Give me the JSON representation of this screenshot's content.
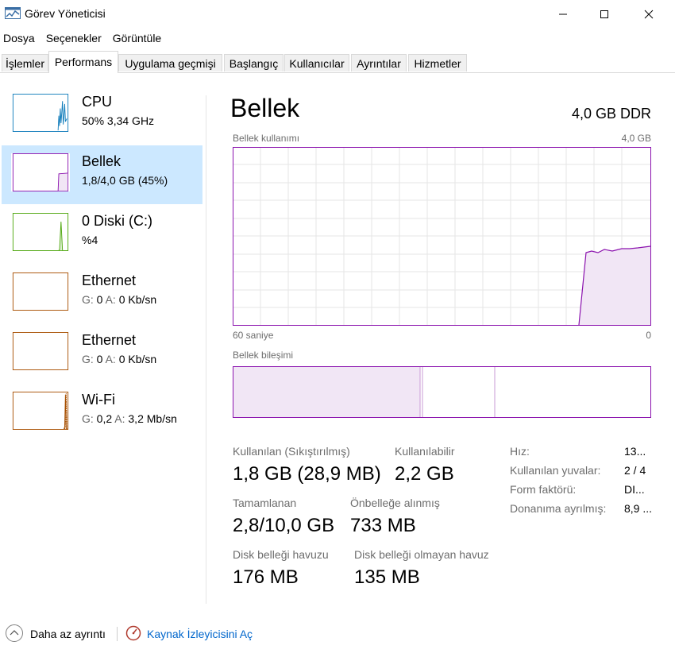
{
  "window": {
    "title": "Görev Yöneticisi",
    "app_icon": "task-manager-icon",
    "controls": [
      "minimize-icon",
      "maximize-icon",
      "close-icon"
    ]
  },
  "menu": {
    "items": [
      "Dosya",
      "Seçenekler",
      "Görüntüle"
    ]
  },
  "tabs": [
    {
      "label": "İşlemler"
    },
    {
      "label": "Performans",
      "active": true
    },
    {
      "label": "Uygulama geçmişi"
    },
    {
      "label": "Başlangıç"
    },
    {
      "label": "Kullanıcılar"
    },
    {
      "label": "Ayrıntılar"
    },
    {
      "label": "Hizmetler"
    }
  ],
  "sidebar": {
    "items": [
      {
        "title": "CPU",
        "subtitle": "50%  3,34 GHz",
        "color": "#117dbb"
      },
      {
        "title": "Bellek",
        "subtitle": "1,8/4,0 GB (45%)",
        "color": "#8b12ae",
        "selected": true
      },
      {
        "title": "0 Diski (C:)",
        "subtitle": "%4",
        "color": "#4da60c"
      },
      {
        "title": "Ethernet",
        "sub_g_label": "G:",
        "sub_g_value": "0",
        "sub_a_label": "A:",
        "sub_a_value": "0 Kb/sn",
        "color": "#a74f01"
      },
      {
        "title": "Ethernet",
        "sub_g_label": "G:",
        "sub_g_value": "0",
        "sub_a_label": "A:",
        "sub_a_value": "0 Kb/sn",
        "color": "#a74f01"
      },
      {
        "title": "Wi-Fi",
        "sub_g_label": "G:",
        "sub_g_value": "0,2",
        "sub_a_label": "A:",
        "sub_a_value": "3,2 Mb/sn",
        "color": "#a74f01"
      }
    ]
  },
  "main": {
    "title": "Bellek",
    "mem_type": "4,0 GB DDR",
    "usage_label": "Bellek kullanımı",
    "usage_max": "4,0 GB",
    "time_left": "60 saniye",
    "time_right": "0",
    "composition_label": "Bellek bileşimi",
    "accent": "#8b12ae",
    "stats": {
      "in_use_label": "Kullanılan (Sıkıştırılmış)",
      "in_use_value": "1,8 GB (28,9 MB)",
      "available_label": "Kullanılabilir",
      "available_value": "2,2 GB",
      "committed_label": "Tamamlanan",
      "committed_value": "2,8/10,0 GB",
      "cached_label": "Önbelleğe alınmış",
      "cached_value": "733 MB",
      "paged_label": "Disk belleği havuzu",
      "paged_value": "176 MB",
      "nonpaged_label": "Disk belleği olmayan havuz",
      "nonpaged_value": "135 MB"
    },
    "details": [
      {
        "label": "Hız:",
        "value": "13..."
      },
      {
        "label": "Kullanılan yuvalar:",
        "value": "2 / 4"
      },
      {
        "label": "Form faktörü:",
        "value": "DI..."
      },
      {
        "label": "Donanıma ayrılmış:",
        "value": "8,9 ..."
      }
    ]
  },
  "footer": {
    "fewer_details": "Daha az ayrıntı",
    "resource_monitor": "Kaynak İzleyicisini Aç",
    "fewer_icon": "chevron-up-circle-icon",
    "monitor_icon": "resource-monitor-icon"
  }
}
